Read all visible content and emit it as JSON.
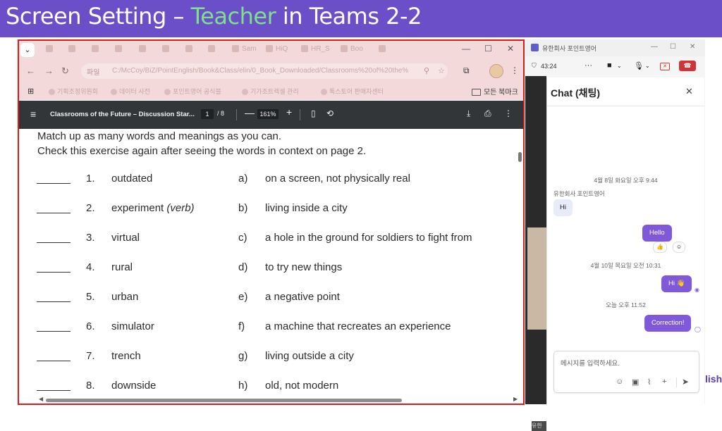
{
  "slide": {
    "title_part1": "Screen Setting – ",
    "title_accent": "Teacher",
    "title_part2": " in Teams 2-2",
    "corner_text": "lish"
  },
  "browser": {
    "tab_menu_icon": "chevron-down-icon",
    "tabs": [
      "Sam",
      "HiQ",
      "HR_S",
      "Boo"
    ],
    "address_prefix": "파일",
    "address_url": "C:/McCoy/BiZ/PointEnglish/Book&Class/elin/0_Book_Downloaded/Classrooms%20of%20the%",
    "bookmarks": [
      "기획조정위원회",
      "데이터 사전",
      "포인트영어 공식블",
      "기가조트렉셀 관리",
      "톡스토어 판매자센터"
    ],
    "all_bookmarks": "모든 북마크"
  },
  "pdf_toolbar": {
    "title": "Classrooms of the Future – Discussion Star...",
    "page_current": "1",
    "page_total": "/ 8",
    "zoom": "161%"
  },
  "pdf": {
    "instruction_1": "Match up as many words and meanings as you can.",
    "instruction_2": "Check this exercise again after seeing the words in context on page 2.",
    "items": [
      {
        "num": "1.",
        "word": "outdated",
        "note": "",
        "letter": "a)",
        "meaning": "on a screen, not physically real"
      },
      {
        "num": "2.",
        "word": "experiment",
        "note": "(verb)",
        "letter": "b)",
        "meaning": "living inside a city"
      },
      {
        "num": "3.",
        "word": "virtual",
        "note": "",
        "letter": "c)",
        "meaning": "a hole in the ground for soldiers to fight from"
      },
      {
        "num": "4.",
        "word": "rural",
        "note": "",
        "letter": "d)",
        "meaning": "to try new things"
      },
      {
        "num": "5.",
        "word": "urban",
        "note": "",
        "letter": "e)",
        "meaning": "a negative point"
      },
      {
        "num": "6.",
        "word": "simulator",
        "note": "",
        "letter": "f)",
        "meaning": "a machine that recreates an experience"
      },
      {
        "num": "7.",
        "word": "trench",
        "note": "",
        "letter": "g)",
        "meaning": "living outside a city"
      },
      {
        "num": "8.",
        "word": "downside",
        "note": "",
        "letter": "h)",
        "meaning": "old, not modern"
      }
    ]
  },
  "teams": {
    "window_title": "유한회사 포인트영어",
    "call_time": "43:24",
    "stage_label": "유한",
    "chat_title": "Chat (채팅)",
    "messages": {
      "stamp_1": "4월 8일 화요일 오후 9:44",
      "sender_1": "유한회사 포인트영어",
      "in_1": "Hi",
      "out_1": "Hello",
      "reaction_1": "👍",
      "stamp_2": "4월 10일 목요일 오전 10:31",
      "out_2": "Hi 👋",
      "stamp_3": "오늘 오후 11:52",
      "out_3": "Correction!"
    },
    "compose_placeholder": "메시지를 입력하세요."
  },
  "colors": {
    "slide_title_bg": "#6a4fc8",
    "title_accent": "#7ee08a",
    "frame_red": "#e31919",
    "teams_bubble_out": "#7f59d9",
    "teams_leave": "#d13438"
  }
}
